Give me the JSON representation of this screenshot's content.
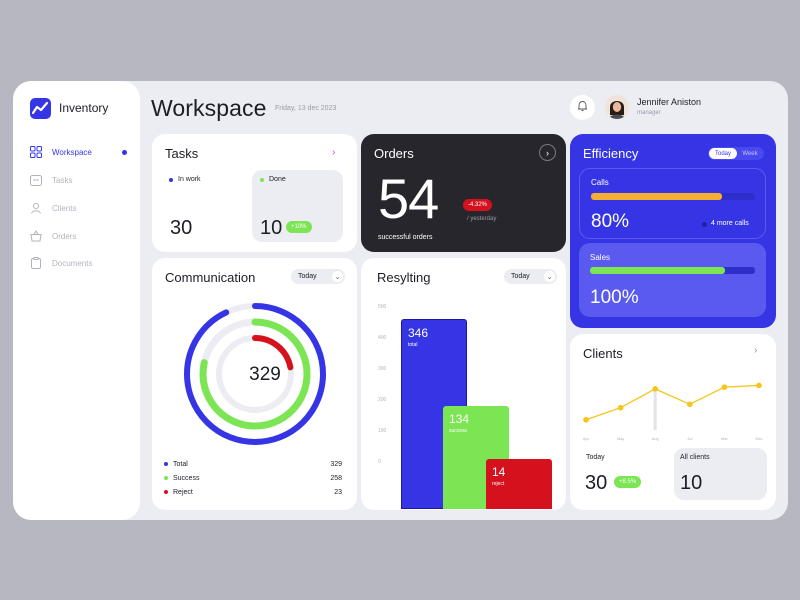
{
  "sidebar": {
    "brand": "Inventory",
    "items": [
      {
        "label": "Workspace",
        "icon": "grid-icon",
        "active": true
      },
      {
        "label": "Tasks",
        "icon": "calendar-icon"
      },
      {
        "label": "Clients",
        "icon": "user-icon"
      },
      {
        "label": "Orders",
        "icon": "basket-icon"
      },
      {
        "label": "Documents",
        "icon": "clipboard-icon"
      }
    ]
  },
  "header": {
    "title": "Workspace",
    "date": "Friday, 13 dec 2023",
    "user_name": "Jennifer Aniston",
    "user_role": "manager"
  },
  "tasks": {
    "title": "Tasks",
    "in_work_label": "In work",
    "in_work_value": "30",
    "done_label": "Done",
    "done_value": "10",
    "done_change": "+10%"
  },
  "orders": {
    "title": "Orders",
    "value": "54",
    "change": "-4.32%",
    "change_caption": "/ yesterday",
    "caption": "successful orders"
  },
  "efficiency": {
    "title": "Efficiency",
    "tabs": [
      "Today",
      "Week"
    ],
    "calls_label": "Calls",
    "calls_value": "80%",
    "calls_progress": 0.8,
    "calls_note": "4 more calls",
    "sales_label": "Sales",
    "sales_value": "100%",
    "sales_progress": 0.82
  },
  "communication": {
    "title": "Communication",
    "period": "Today",
    "center_value": "329",
    "legend": [
      {
        "label": "Total",
        "value": "329",
        "color": "#3535e6"
      },
      {
        "label": "Success",
        "value": "258",
        "color": "#7ce553"
      },
      {
        "label": "Reject",
        "value": "23",
        "color": "#d6111e"
      }
    ]
  },
  "results": {
    "title": "Resylting",
    "period": "Today",
    "y_ticks": [
      "500",
      "400",
      "300",
      "200",
      "100",
      "0"
    ],
    "chart_data": {
      "type": "bar",
      "categories": [
        "total",
        "success",
        "reject"
      ],
      "values": [
        346,
        134,
        14
      ],
      "colors": [
        "#3535e6",
        "#7ce553",
        "#d6111e"
      ]
    }
  },
  "clients": {
    "title": "Clients",
    "x_ticks": [
      "Apr",
      "May",
      "Aug",
      "Jul",
      "Mar",
      "Dec"
    ],
    "chart_data": {
      "type": "line",
      "x": [
        "Apr",
        "May",
        "Aug",
        "Jul",
        "Mar",
        "Dec"
      ],
      "values": [
        12,
        26,
        48,
        30,
        50,
        52
      ],
      "ylim": [
        0,
        70
      ],
      "color": "#f5c518"
    },
    "today_label": "Today",
    "today_value": "30",
    "today_change": "+8.5%",
    "all_label": "All clients",
    "all_value": "10"
  }
}
